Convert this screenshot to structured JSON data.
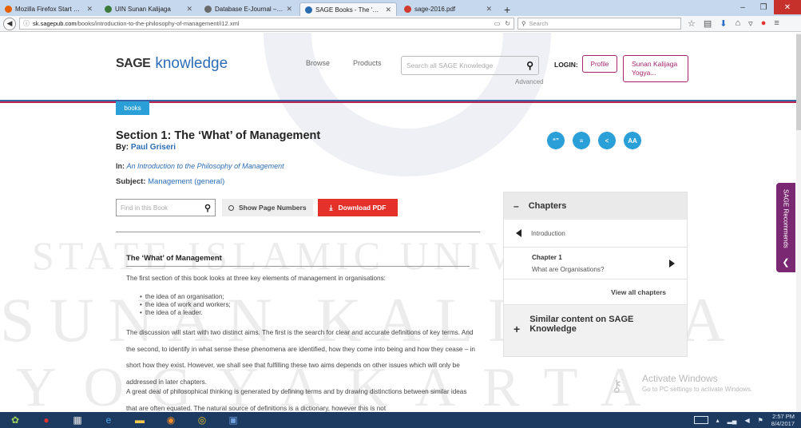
{
  "browser": {
    "tabs": [
      {
        "label": "Mozilla Firefox Start Page",
        "favicon_color": "#e66000",
        "active": false
      },
      {
        "label": "UIN Sunan Kalijaga",
        "favicon_color": "#3b7a3b",
        "active": false
      },
      {
        "label": "Database E-Journal – PERPUSTA",
        "favicon_color": "#6a6a6a",
        "active": false
      },
      {
        "label": "SAGE Books - The 'What' of",
        "favicon_color": "#2b6cb0",
        "active": true
      },
      {
        "label": "sage-2016.pdf",
        "favicon_color": "#d03a2f",
        "active": false
      }
    ],
    "new_tab": "+",
    "url_host": "sk.sagepub.com",
    "url_path": "/books/introduction-to-the-philosophy-of-management/i12.xml",
    "search_placeholder": "Search",
    "window_buttons": {
      "minimize": "–",
      "maximize": "❐",
      "close": "✕"
    }
  },
  "site": {
    "logo_sage": "SAGE",
    "logo_knowledge": "knowledge",
    "nav": {
      "browse": "Browse",
      "products": "Products"
    },
    "search_placeholder": "Search all SAGE Knowledge",
    "advanced": "Advanced",
    "login_label": "LOGIN:",
    "profile_button": "Profile",
    "user_button": "Sunan Kalijaga Yogya..."
  },
  "content": {
    "tag": "books",
    "section_title": "Section 1: The ‘What’ of Management",
    "by_label": "By:",
    "author": "Paul Griseri",
    "in_label": "In:",
    "book_title": "An Introduction to the Philosophy of Management",
    "subject_label": "Subject:",
    "subject": "Management (general)",
    "find_placeholder": "Find in this Book",
    "show_page_numbers": "Show Page Numbers",
    "download_pdf": "Download PDF",
    "heading": "The ‘What’ of Management",
    "para1": "The first section of this book looks at three key elements of management in organisations:",
    "bullets": [
      "the idea of an organisation;",
      "the idea of work and workers;",
      "the idea of a leader."
    ],
    "para2": "The discussion will start with two distinct aims. The first is the search for clear and accurate definitions of key terms. And the second, to identify in what sense these phenomena are identified, how they come into being and how they cease – in short how they exist. However, we shall see that fulfilling these two aims depends on other issues which will only be addressed in later chapters.",
    "para3": "A great deal of philosophical thinking is generated by defining terms and by drawing distinctions between similar ideas that are often equated. The natural source of definitions is a dictionary, however this is not"
  },
  "sidebar": {
    "action_icons": [
      "“”",
      "≡",
      "<",
      "AA"
    ],
    "chapters_title": "Chapters",
    "prev_chapter": "Introduction",
    "next_chapter_number": "Chapter 1",
    "next_chapter_title": "What are Organisations?",
    "view_all": "View all chapters",
    "similar_title": "Similar content on SAGE Knowledge",
    "recommends": "SAGE Recommends"
  },
  "watermark": {
    "line1": "STATE ISLAMIC UNIVERSITY",
    "line2": "SUNAN KALIJAGA",
    "line3": "YOGYAKARTA"
  },
  "activation": {
    "title": "Activate Windows",
    "subtitle": "Go to PC settings to activate Windows."
  },
  "taskbar": {
    "time": "2:57 PM",
    "date": "8/4/2017"
  }
}
